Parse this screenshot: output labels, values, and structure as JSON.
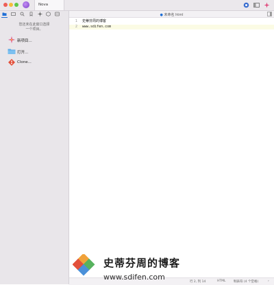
{
  "window": {
    "title": "Nova"
  },
  "sidebar": {
    "hint_line1": "您还未在此窗口选择",
    "hint_line2": "一个项目。",
    "actions": [
      {
        "label": "新项目..."
      },
      {
        "label": "打开..."
      },
      {
        "label": "Clone..."
      }
    ]
  },
  "editor": {
    "tab_title": "未命名 html",
    "lines": [
      {
        "no": "1",
        "text": "史蒂芬周的博客"
      },
      {
        "no": "2",
        "text": "www.sdifen.com"
      }
    ]
  },
  "statusbar": {
    "position": "行 2, 列 14",
    "language": "HTML",
    "indent": "制表符 (4 个空格)"
  },
  "watermark": {
    "title": "史蒂芬周的博客",
    "url": "www.sdifen.com"
  },
  "colors": {
    "accent": "#1f6fd6",
    "current_line": "#fbfbe4"
  }
}
